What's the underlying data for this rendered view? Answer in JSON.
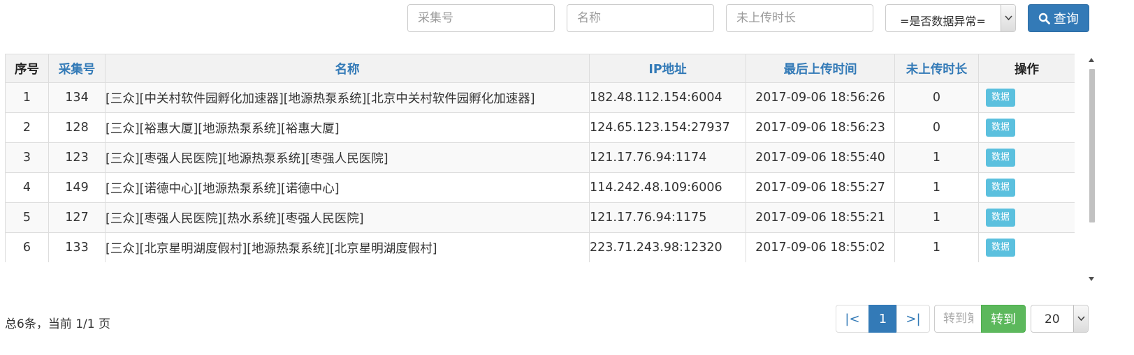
{
  "search": {
    "code_placeholder": "采集号",
    "name_placeholder": "名称",
    "duration_placeholder": "未上传时长",
    "anomaly_select_value": "=是否数据异常=",
    "query_label": "查询"
  },
  "table": {
    "headers": {
      "index": "序号",
      "code": "采集号",
      "name": "名称",
      "ip": "IP地址",
      "last_upload": "最后上传时间",
      "not_uploaded": "未上传时长",
      "actions": "操作"
    },
    "rows": [
      {
        "index": "1",
        "code": "134",
        "name": "[三众][中关村软件园孵化加速器][地源热泵系统][北京中关村软件园孵化加速器]",
        "ip": "182.48.112.154:6004",
        "last_upload": "2017-09-06 18:56:26",
        "not_uploaded": "0",
        "action": "数据"
      },
      {
        "index": "2",
        "code": "128",
        "name": "[三众][裕惠大厦][地源热泵系统][裕惠大厦]",
        "ip": "124.65.123.154:27937",
        "last_upload": "2017-09-06 18:56:23",
        "not_uploaded": "0",
        "action": "数据"
      },
      {
        "index": "3",
        "code": "123",
        "name": "[三众][枣强人民医院][地源热泵系统][枣强人民医院]",
        "ip": "121.17.76.94:1174",
        "last_upload": "2017-09-06 18:55:40",
        "not_uploaded": "1",
        "action": "数据"
      },
      {
        "index": "4",
        "code": "149",
        "name": "[三众][诺德中心][地源热泵系统][诺德中心]",
        "ip": "114.242.48.109:6006",
        "last_upload": "2017-09-06 18:55:27",
        "not_uploaded": "1",
        "action": "数据"
      },
      {
        "index": "5",
        "code": "127",
        "name": "[三众][枣强人民医院][热水系统][枣强人民医院]",
        "ip": "121.17.76.94:1175",
        "last_upload": "2017-09-06 18:55:21",
        "not_uploaded": "1",
        "action": "数据"
      },
      {
        "index": "6",
        "code": "133",
        "name": "[三众][北京星明湖度假村][地源热泵系统][北京星明湖度假村]",
        "ip": "223.71.243.98:12320",
        "last_upload": "2017-09-06 18:55:02",
        "not_uploaded": "1",
        "action": "数据"
      }
    ]
  },
  "footer": {
    "summary": "总6条，当前 1/1 页",
    "pager": {
      "first": "|<",
      "current": "1",
      "last": ">|"
    },
    "goto_placeholder": "转到第",
    "goto_label": "转到",
    "page_size": "20"
  },
  "icons": {
    "query": "search-icon",
    "select_arrow": "chevron-down-icon",
    "scroll_up": "triangle-up-icon",
    "scroll_down": "triangle-down-icon"
  },
  "colors": {
    "primary": "#337ab7",
    "info": "#5bc0de",
    "success": "#5cb85c"
  }
}
